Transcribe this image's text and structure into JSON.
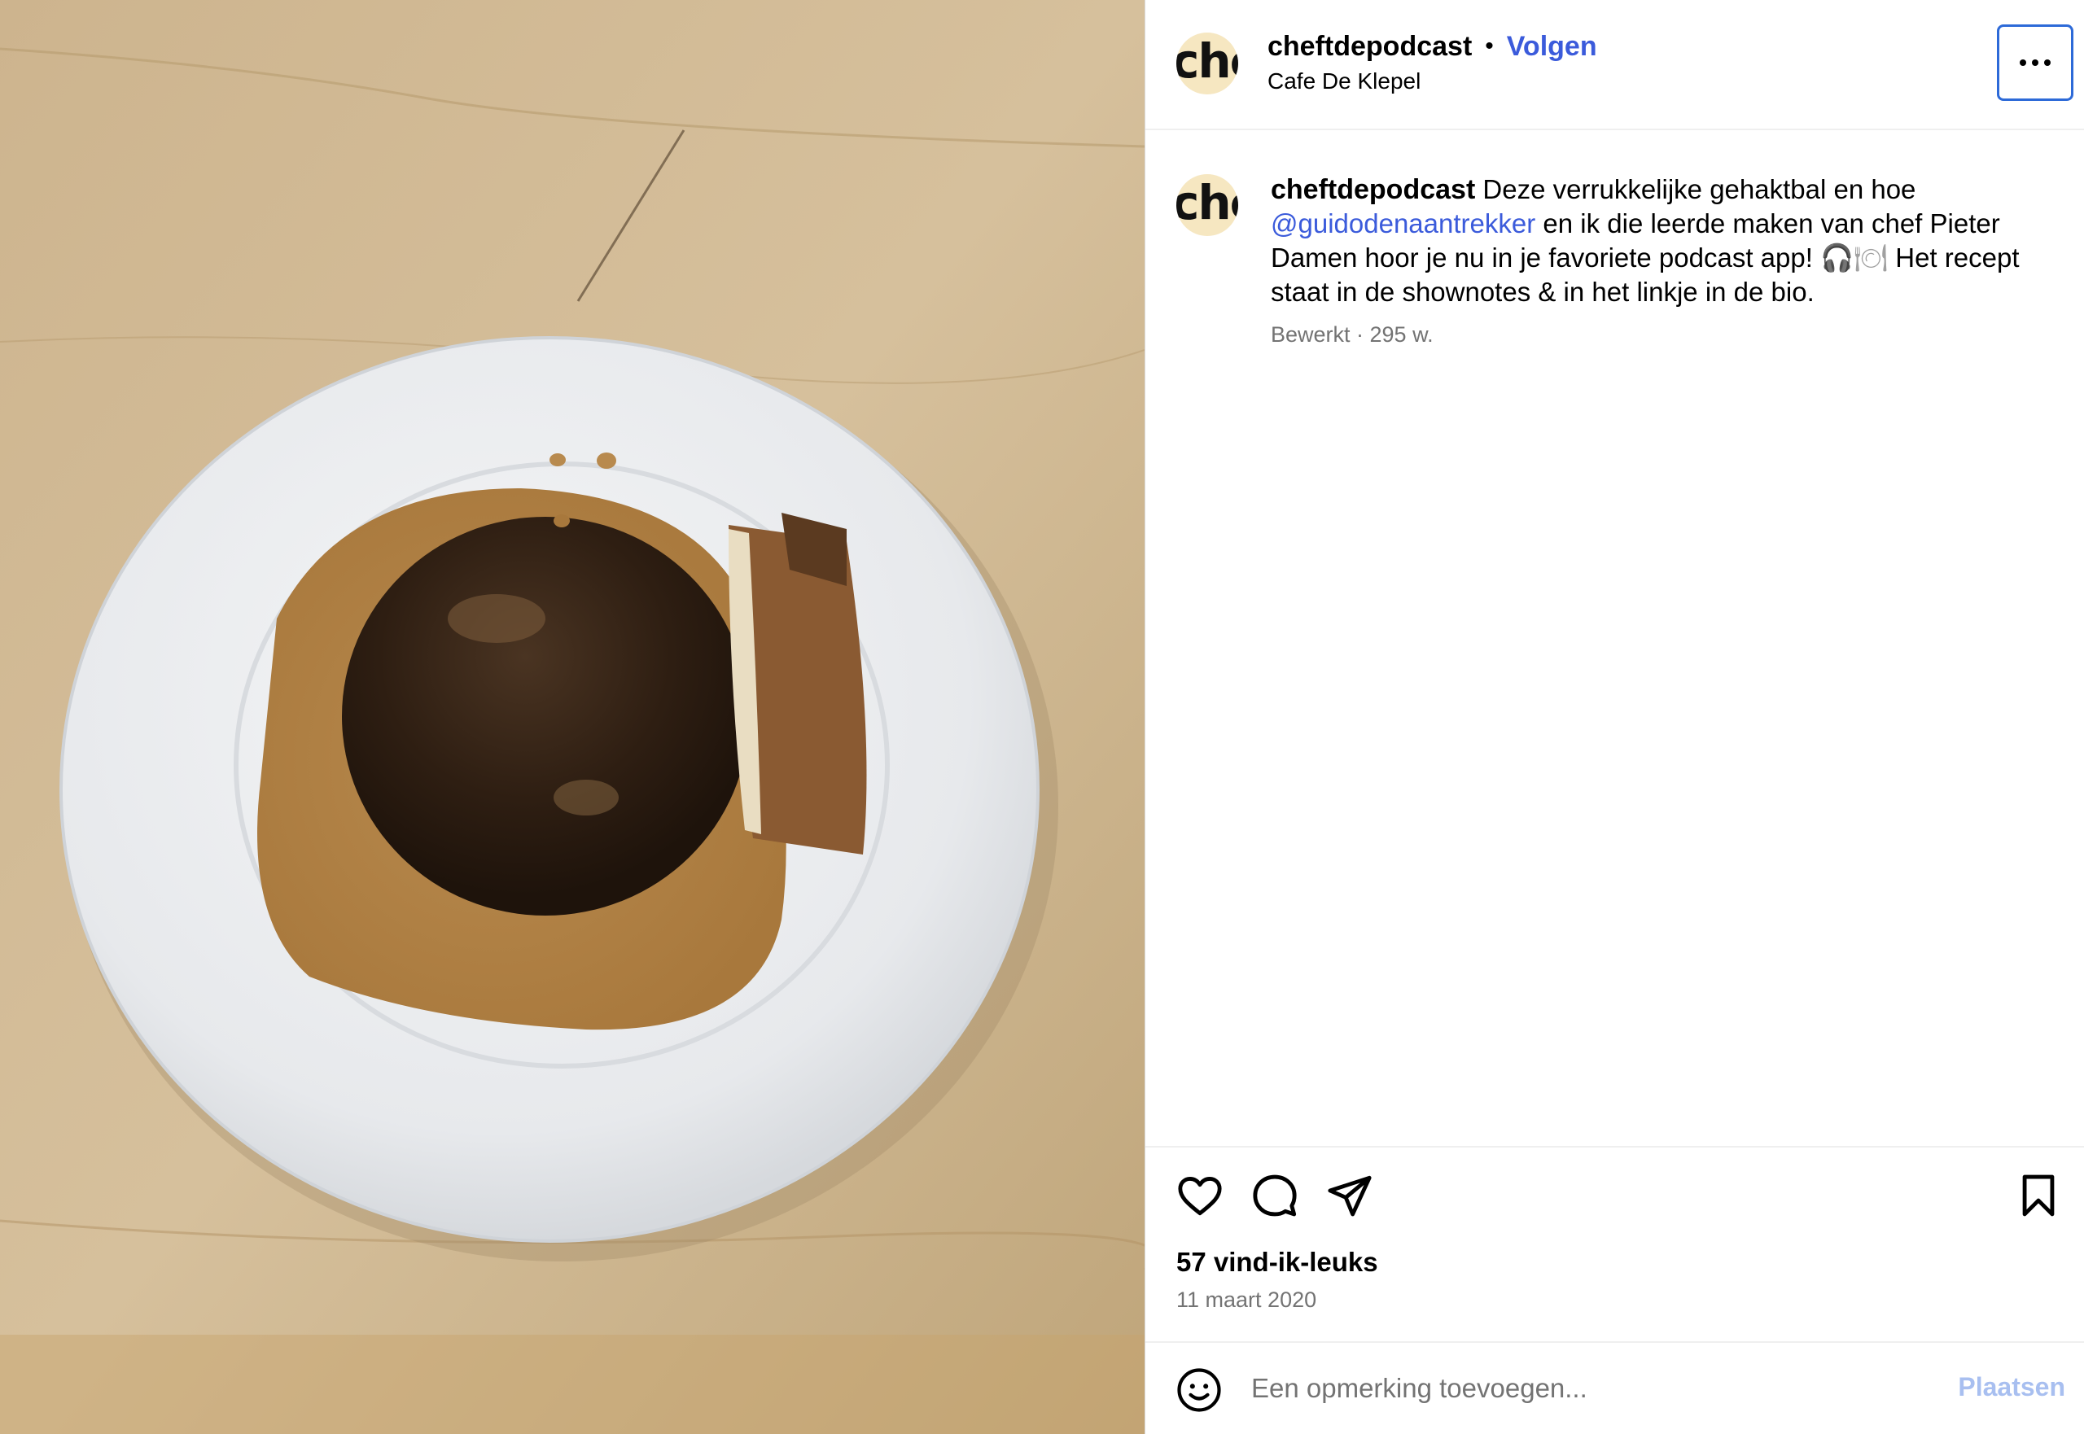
{
  "post": {
    "username": "cheftdepodcast",
    "separator": "•",
    "follow_label": "Volgen",
    "location": "Cafe De Klepel",
    "avatar_text": "che",
    "more_icon": "more-horizontal-icon"
  },
  "caption": {
    "username": "cheftdepodcast",
    "text_1": " Deze verrukkelijke gehaktbal en hoe ",
    "mention": "@guidodenaantrekker",
    "text_2": " en ik die leerde maken van chef Pieter Damen hoor je nu in je favoriete podcast app! ",
    "emoji": "🎧🍽",
    "text_3": " Het recept staat in de shownotes & in het linkje in de bio.",
    "meta": "Bewerkt · 295 w."
  },
  "actions": {
    "like_icon": "heart-icon",
    "comment_icon": "comment-icon",
    "share_icon": "send-icon",
    "save_icon": "bookmark-icon",
    "likes": "57 vind-ik-leuks",
    "date": "11 maart 2020"
  },
  "comment": {
    "emoji_icon": "smiley-icon",
    "placeholder": "Een opmerking toevoegen...",
    "post_label": "Plaatsen"
  },
  "colors": {
    "accent": "#3b5bdb",
    "muted": "#737373",
    "post_disabled": "#a8bff0",
    "more_border": "#2d6ad8"
  }
}
